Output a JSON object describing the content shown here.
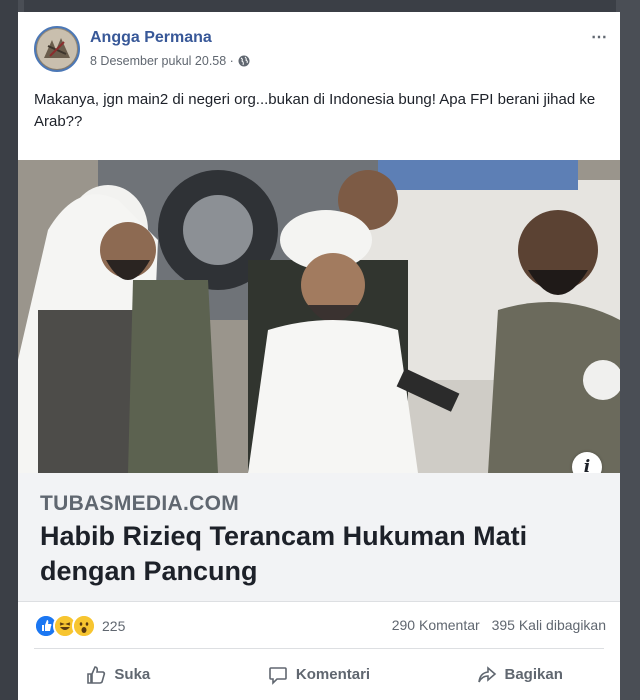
{
  "post": {
    "author": "Angga Permana",
    "timestamp": "8 Desember pukul 20.58 ·",
    "text": "Makanya, jgn main2 di negeri org...bukan di Indonesia bung! Apa FPI berani jihad ke Arab??",
    "more_icon": "⋯"
  },
  "link_preview": {
    "domain": "TUBASMEDIA.COM",
    "title": "Habib Rizieq Terancam Hukuman Mati dengan Pancung",
    "info_icon": "i"
  },
  "stats": {
    "reaction_count": "225",
    "comments": "290 Komentar",
    "shares": "395 Kali dibagikan"
  },
  "actions": {
    "like": "Suka",
    "comment": "Komentari",
    "share": "Bagikan"
  },
  "colors": {
    "author_link": "#385898",
    "like_blue": "#1b77f2",
    "reaction_yellow": "#f7c530"
  }
}
